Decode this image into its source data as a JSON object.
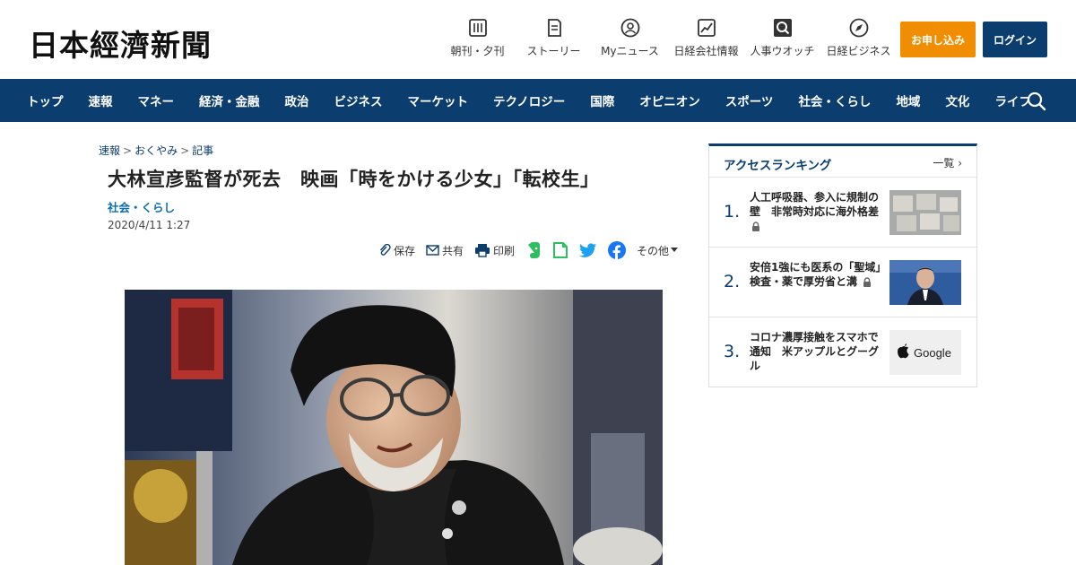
{
  "header": {
    "logo": "日本經濟新聞",
    "icons": [
      {
        "label": "朝刊・夕刊",
        "icon": "newspaper-icon"
      },
      {
        "label": "ストーリー",
        "icon": "book-icon"
      },
      {
        "label": "Myニュース",
        "icon": "user-icon"
      },
      {
        "label": "日経会社情報",
        "icon": "chart-icon"
      },
      {
        "label": "人事ウオッチ",
        "icon": "search-person-icon"
      },
      {
        "label": "日経ビジネス",
        "icon": "compass-icon"
      }
    ],
    "apply_label": "お申し込み",
    "login_label": "ログイン"
  },
  "nav": {
    "items": [
      "トップ",
      "速報",
      "マネー",
      "経済・金融",
      "政治",
      "ビジネス",
      "マーケット",
      "テクノロジー",
      "国際",
      "オピニオン",
      "スポーツ",
      "社会・くらし",
      "地域",
      "文化",
      "ライフ"
    ]
  },
  "breadcrumb": [
    "速報",
    "おくやみ",
    "記事"
  ],
  "article": {
    "headline": "大林宣彦監督が死去　映画「時をかける少女」「転校生」",
    "category": "社会・くらし",
    "date": "2020/4/11 1:27"
  },
  "share": {
    "save_label": "保存",
    "share_label": "共有",
    "print_label": "印刷",
    "more_label": "その他"
  },
  "colors": {
    "brand_navy": "#0b3d6f",
    "apply_orange": "#f18d00"
  },
  "ranking": {
    "title": "アクセスランキング",
    "more_label": "一覧",
    "items": [
      {
        "rank": "1.",
        "text": "人工呼吸器、参入に規制の壁　非常時対応に海外格差",
        "locked": true
      },
      {
        "rank": "2.",
        "text": "安倍1強にも医系の「聖域」　検査・薬で厚労省と溝",
        "locked": true
      },
      {
        "rank": "3.",
        "text": "コロナ濃厚接触をスマホで通知　米アップルとグーグル",
        "locked": false
      }
    ]
  },
  "thumb3": {
    "logo_text": "Google"
  }
}
